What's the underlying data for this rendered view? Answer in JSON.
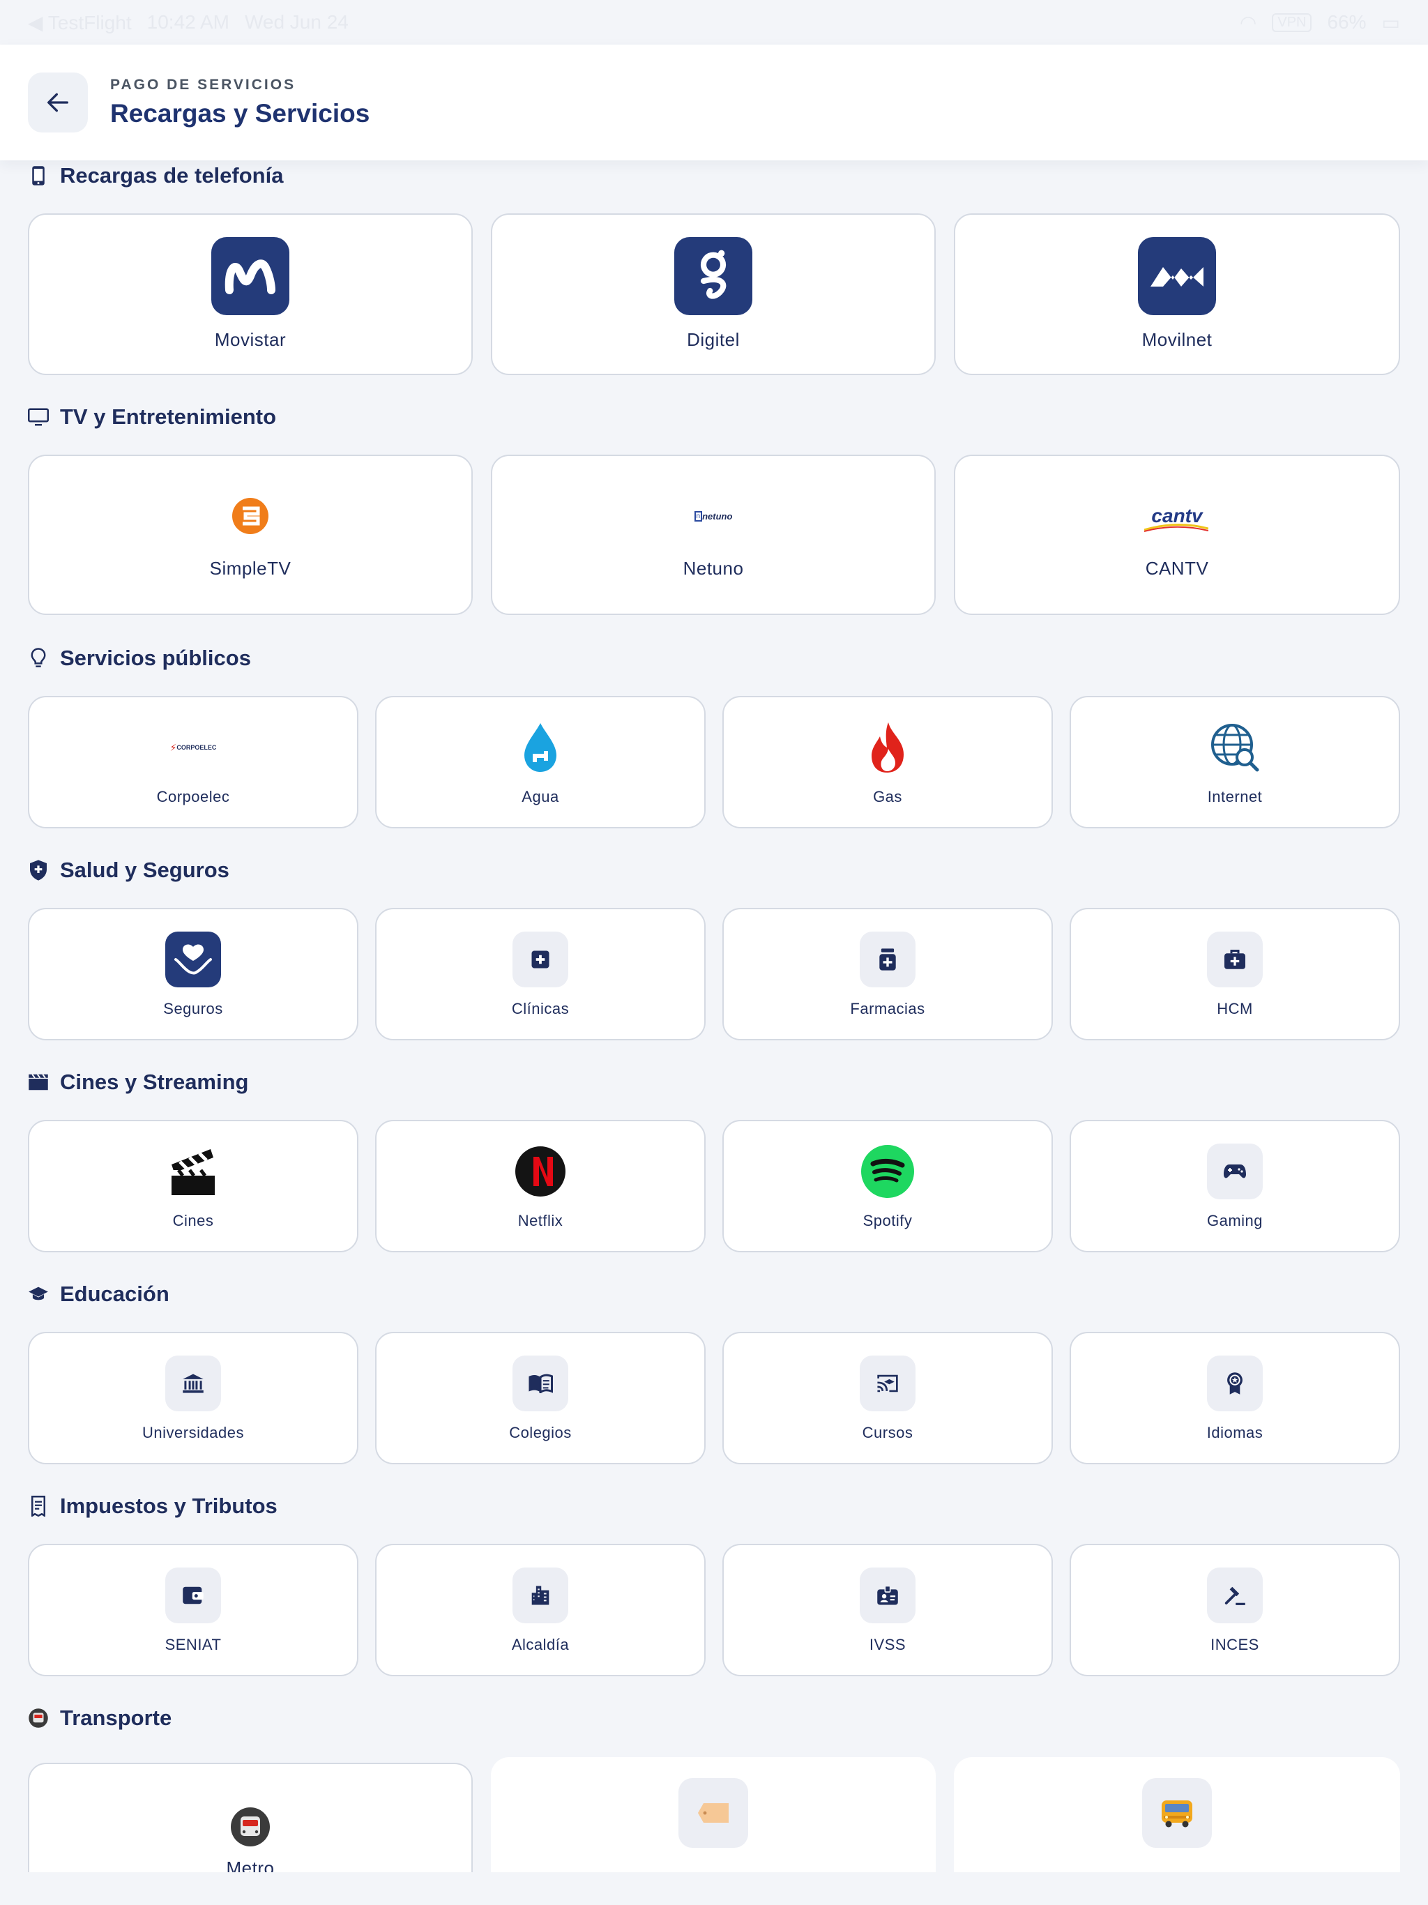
{
  "status_bar": {
    "app": "◀ TestFlight",
    "time": "10:42 AM",
    "date": "Wed Jun 24",
    "vpn": "VPN",
    "battery": "66%"
  },
  "header": {
    "kicker": "PAGO DE SERVICIOS",
    "title": "Recargas y Servicios"
  },
  "sections": [
    {
      "title": "Recargas de telefonía",
      "items": [
        {
          "label": "Movistar",
          "icon": "movistar-logo"
        },
        {
          "label": "Digitel",
          "icon": "digitel-logo"
        },
        {
          "label": "Movilnet",
          "icon": "movilnet-logo"
        }
      ]
    },
    {
      "title": "TV y Entretenimiento",
      "items": [
        {
          "label": "SimpleTV",
          "icon": "simpletv-logo"
        },
        {
          "label": "Netuno",
          "icon": "netuno-logo",
          "logo_text": "netuno"
        },
        {
          "label": "CANTV",
          "icon": "cantv-logo",
          "logo_text": "cantv"
        }
      ]
    },
    {
      "title": "Servicios públicos",
      "items": [
        {
          "label": "Corpoelec",
          "icon": "corpoelec-logo",
          "logo_text": "CORPOELEC"
        },
        {
          "label": "Agua",
          "icon": "water-drop-icon"
        },
        {
          "label": "Gas",
          "icon": "flame-icon"
        },
        {
          "label": "Internet",
          "icon": "globe-search-icon"
        }
      ]
    },
    {
      "title": "Salud y Seguros",
      "items": [
        {
          "label": "Seguros",
          "icon": "care-hands-icon"
        },
        {
          "label": "Clínicas",
          "icon": "medical-cross-icon"
        },
        {
          "label": "Farmacias",
          "icon": "medicine-bottle-icon"
        },
        {
          "label": "HCM",
          "icon": "medical-kit-icon"
        }
      ]
    },
    {
      "title": "Cines y Streaming",
      "items": [
        {
          "label": "Cines",
          "icon": "clapperboard-icon"
        },
        {
          "label": "Netflix",
          "icon": "netflix-logo"
        },
        {
          "label": "Spotify",
          "icon": "spotify-logo"
        },
        {
          "label": "Gaming",
          "icon": "gamepad-icon"
        }
      ]
    },
    {
      "title": "Educación",
      "items": [
        {
          "label": "Universidades",
          "icon": "institution-icon"
        },
        {
          "label": "Colegios",
          "icon": "open-book-icon"
        },
        {
          "label": "Cursos",
          "icon": "cast-education-icon"
        },
        {
          "label": "Idiomas",
          "icon": "award-icon"
        }
      ]
    },
    {
      "title": "Impuestos y Tributos",
      "items": [
        {
          "label": "SENIAT",
          "icon": "wallet-icon"
        },
        {
          "label": "Alcaldía",
          "icon": "city-buildings-icon"
        },
        {
          "label": "IVSS",
          "icon": "id-badge-icon"
        },
        {
          "label": "INCES",
          "icon": "gavel-icon"
        }
      ]
    },
    {
      "title": "Transporte",
      "items": [
        {
          "label": "Metro",
          "icon": "metro-train-icon"
        },
        {
          "label": "",
          "icon": "ticket-tag-icon"
        },
        {
          "label": "",
          "icon": "bus-icon"
        }
      ]
    }
  ],
  "colors": {
    "brand_navy": "#243b7a",
    "text_dark": "#1f2d5c",
    "simpletv_orange": "#f07d1a",
    "gas_red": "#e0231b",
    "water_blue": "#1aa3e0",
    "spotify_green": "#1ed760",
    "netflix_red": "#e50914"
  }
}
